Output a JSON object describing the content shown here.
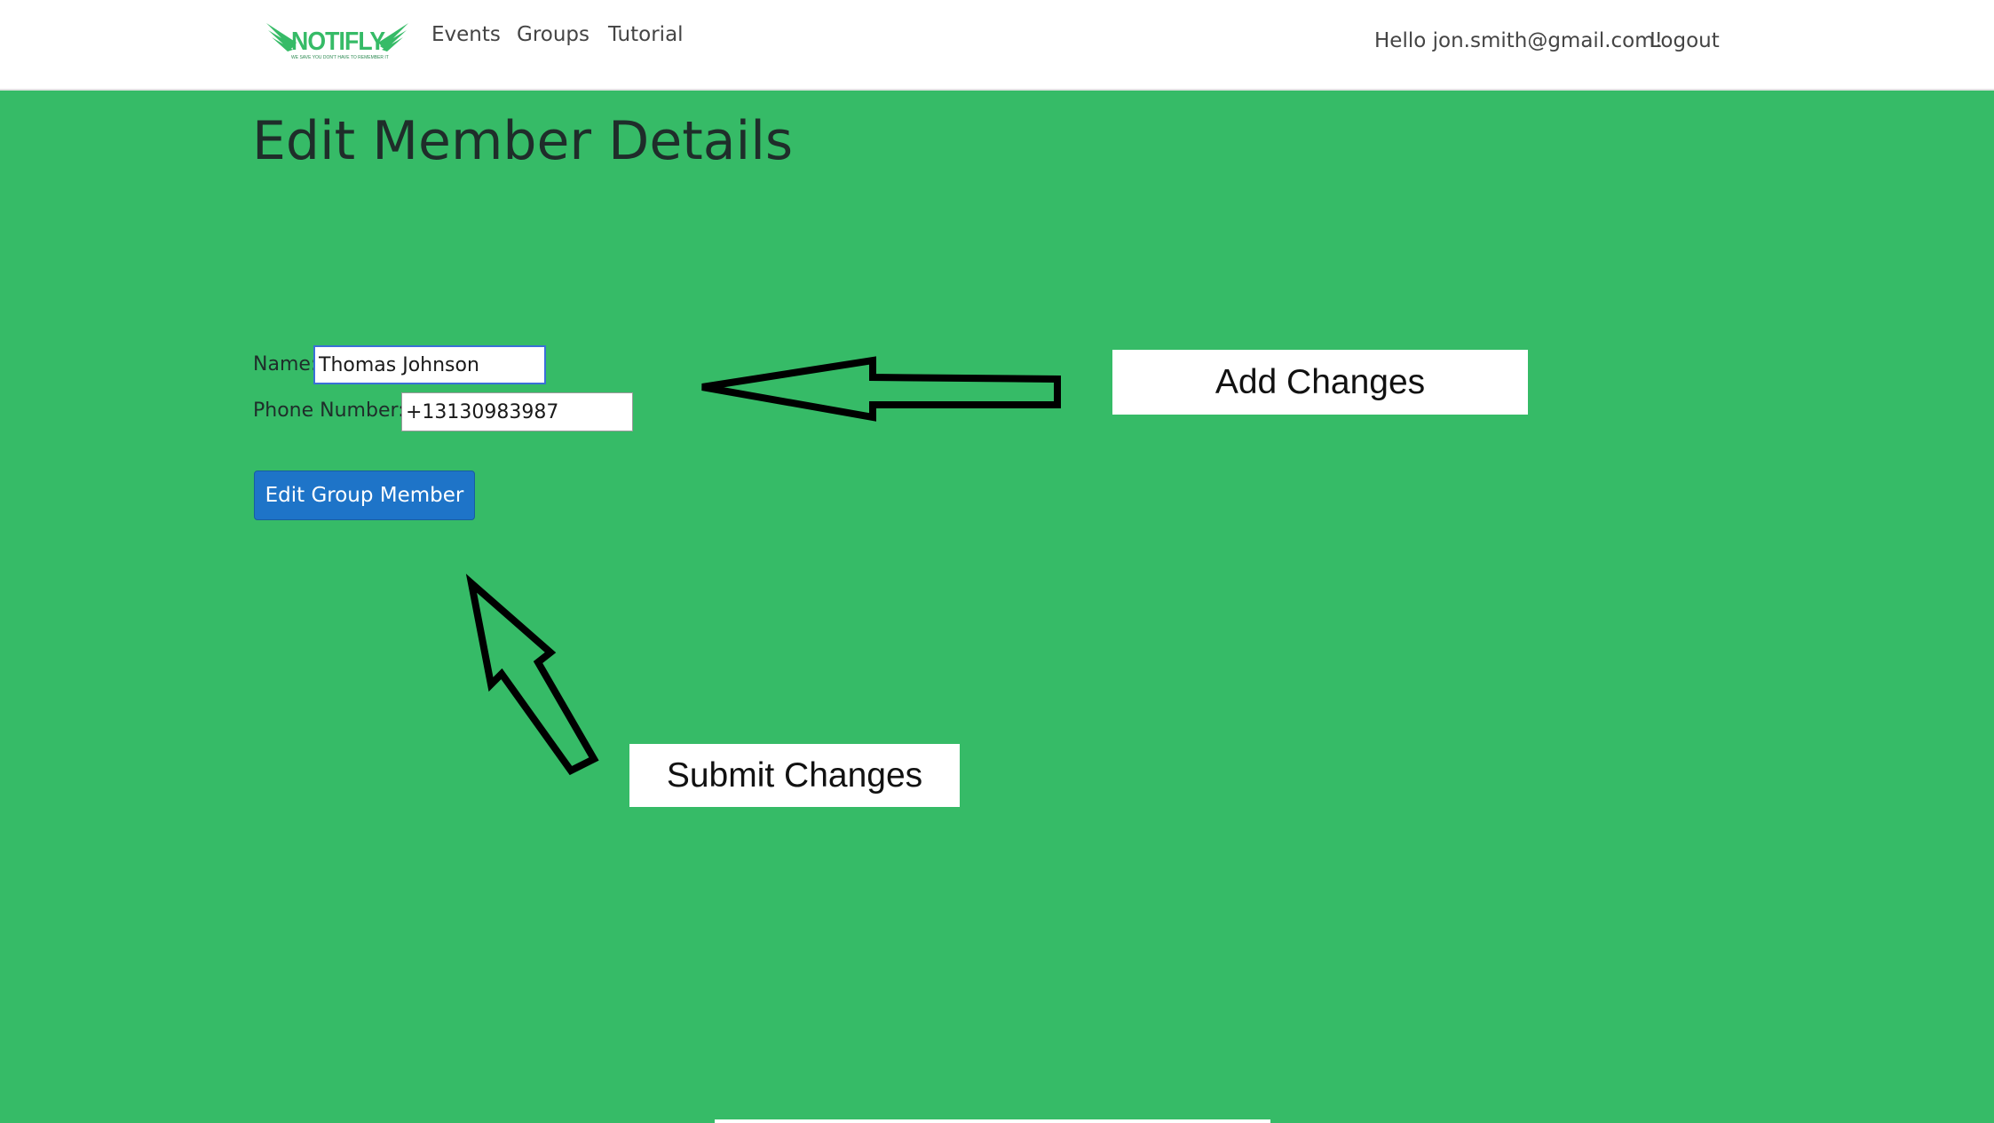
{
  "brand": {
    "logo_text": "NOTIFLY",
    "tagline": "WE SAVE YOU DON'T HAVE TO REMEMBER IT",
    "accent_color": "#36bb67"
  },
  "nav": {
    "links": [
      "Events",
      "Groups",
      "Tutorial"
    ],
    "greeting": "Hello jon.smith@gmail.com!",
    "logout": "Logout"
  },
  "page": {
    "title": "Edit Member Details",
    "background_color": "#36bb67"
  },
  "form": {
    "name_label": "Name:",
    "name_value": "Thomas Johnson",
    "phone_label": "Phone Number:",
    "phone_value": "+13130983987",
    "submit_label": "Edit Group Member",
    "button_color": "#1e74c8"
  },
  "annotations": {
    "add_changes": "Add Changes",
    "submit_changes": "Submit Changes",
    "arrow_icons": [
      "arrow-left-icon",
      "arrow-up-icon"
    ]
  }
}
